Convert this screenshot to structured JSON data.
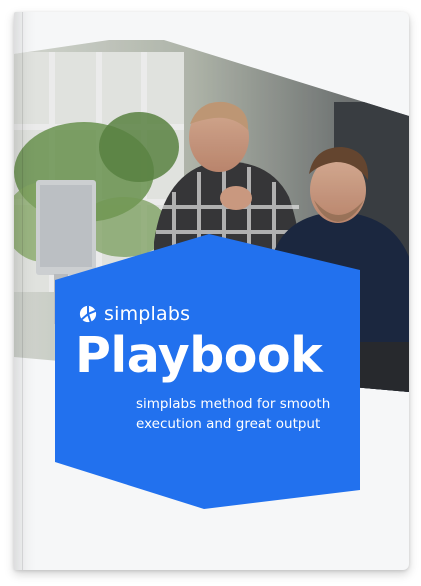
{
  "cover": {
    "brand_name": "simplabs",
    "title": "Playbook",
    "subtitle": "simplabs method for smooth execution and great output"
  },
  "colors": {
    "brand_blue": "#2271ee",
    "page_background": "#ffffff",
    "book_cover": "#f6f7f8"
  },
  "icons": {
    "logo": "simplabs-logo-icon"
  },
  "image": {
    "photo": "photo-two-men-at-computer"
  }
}
